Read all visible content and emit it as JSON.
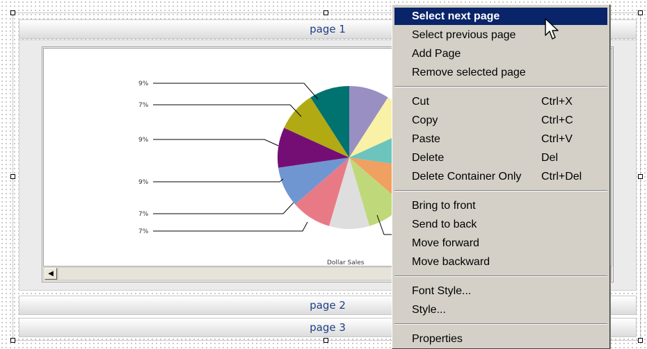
{
  "pages": [
    {
      "label": "page 1"
    },
    {
      "label": "page 2"
    },
    {
      "label": "page 3"
    }
  ],
  "chart": {
    "caption": "Dollar Sales",
    "visible_labels": [
      "9%",
      "7%",
      "9%",
      "9%",
      "7%",
      "7%"
    ]
  },
  "chart_data": {
    "type": "pie",
    "title": "",
    "caption": "Dollar Sales",
    "slice_colors": [
      "#9a8fc2",
      "#f8f1a6",
      "#6cc4bd",
      "#f0a060",
      "#bfd97a",
      "#dedede",
      "#e87a86",
      "#7096d2",
      "#740e74",
      "#b1aa13",
      "#007270"
    ],
    "visible_labels": [
      "9%",
      "7%",
      "9%",
      "9%",
      "7%",
      "7%"
    ],
    "note_values_partial": [
      9,
      7,
      9,
      9,
      7,
      7
    ]
  },
  "scrollbar": {
    "left_arrow": "◀"
  },
  "context_menu": {
    "groups": [
      [
        {
          "label": "Select next page",
          "shortcut": "",
          "highlighted": true
        },
        {
          "label": "Select previous page",
          "shortcut": ""
        },
        {
          "label": "Add Page",
          "shortcut": ""
        },
        {
          "label": "Remove selected page",
          "shortcut": ""
        }
      ],
      [
        {
          "label": "Cut",
          "shortcut": "Ctrl+X"
        },
        {
          "label": "Copy",
          "shortcut": "Ctrl+C"
        },
        {
          "label": "Paste",
          "shortcut": "Ctrl+V"
        },
        {
          "label": "Delete",
          "shortcut": "Del"
        },
        {
          "label": "Delete Container Only",
          "shortcut": "Ctrl+Del"
        }
      ],
      [
        {
          "label": "Bring to front",
          "shortcut": ""
        },
        {
          "label": "Send to back",
          "shortcut": ""
        },
        {
          "label": "Move forward",
          "shortcut": ""
        },
        {
          "label": "Move backward",
          "shortcut": ""
        }
      ],
      [
        {
          "label": "Font Style...",
          "shortcut": ""
        },
        {
          "label": "Style...",
          "shortcut": ""
        }
      ],
      [
        {
          "label": "Properties",
          "shortcut": ""
        }
      ]
    ]
  },
  "colors": {
    "menu_bg": "#d4d0c8",
    "menu_highlight": "#0a246a",
    "page_tab_text": "#1c3f86"
  },
  "icons": [
    "mouse-pointer-icon",
    "scroll-left-arrow-icon"
  ]
}
